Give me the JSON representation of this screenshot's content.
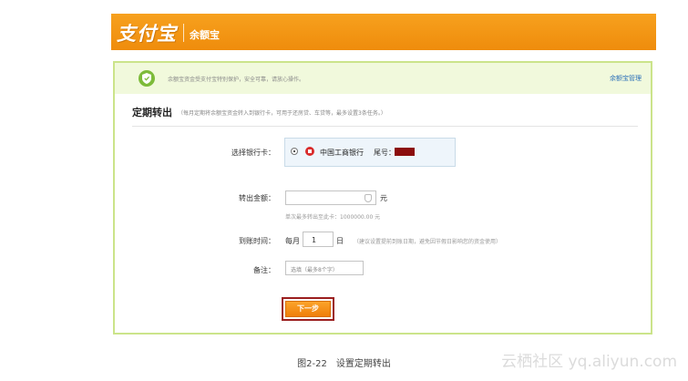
{
  "header": {
    "brand": "支付宝",
    "product": "余额宝"
  },
  "notice": {
    "text": "余额宝资金受支付宝特别保护，安全可靠，请放心操作。",
    "manage_link": "余额宝管理"
  },
  "section": {
    "title": "定期转出",
    "description": "（每月定期将余额宝资金转入到银行卡，可用于还房贷、车贷等，最多设置3条任务。）"
  },
  "form": {
    "bank_label": "选择银行卡：",
    "bank_name": "中国工商银行",
    "tail_label": "尾号：",
    "amount_label": "转出金额：",
    "amount_value": "",
    "amount_unit": "元",
    "amount_hint": "单次最多转出至此卡：1000000.00 元",
    "date_label": "到账时间：",
    "month_prefix": "每月",
    "day_value": "1",
    "day_unit": "日",
    "date_hint": "（建议设置提前到账日期，避免因节假日影响您的资金使用）",
    "note_label": "备注：",
    "note_placeholder": "选填（最多8个字）",
    "next_button": "下一步"
  },
  "caption": "图2-22　设置定期转出",
  "watermark": "云栖社区 yq.aliyun.com",
  "colors": {
    "header_orange": "#f29410",
    "panel_border": "#cbe48a",
    "notice_bg": "#f1f9dc",
    "link_blue": "#2b6fb8",
    "button_orange": "#f39016"
  }
}
